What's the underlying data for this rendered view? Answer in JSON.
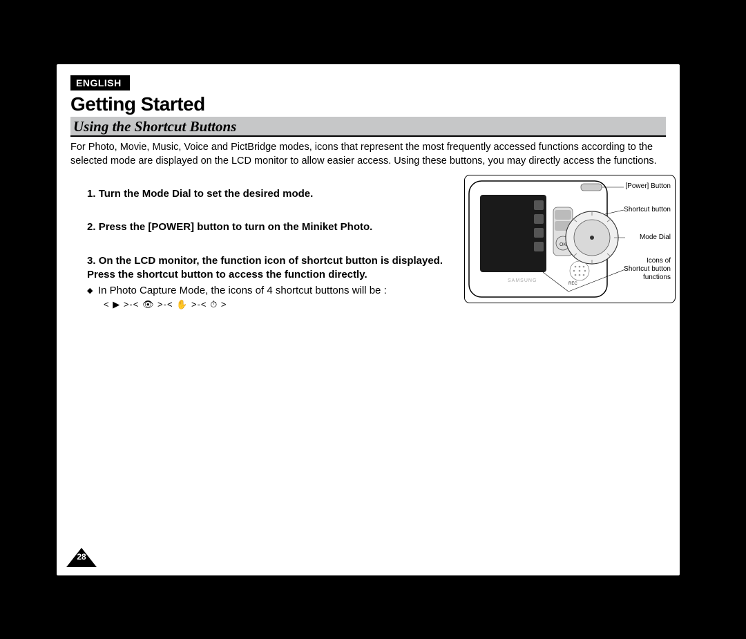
{
  "header": {
    "language": "ENGLISH",
    "title": "Getting Started",
    "subtitle": "Using the Shortcut Buttons"
  },
  "intro": "For Photo, Movie, Music, Voice and PictBridge modes, icons that represent the most frequently accessed functions according to the selected mode are displayed on the LCD monitor to allow easier access. Using these buttons, you may directly access the functions.",
  "steps": [
    {
      "text": "Turn the Mode Dial to set the desired mode."
    },
    {
      "text": "Press the [POWER] button to turn on the Miniket Photo."
    },
    {
      "text": "On the LCD monitor, the function icon of shortcut button is displayed.",
      "extra": "Press the shortcut button to access the function directly.",
      "bullet": "In Photo Capture Mode, the icons of 4 shortcut buttons will be :",
      "iconsLine": "<  ▶  >-<  👁  >-<  ✋  >-<  ⏱  >"
    }
  ],
  "diagram": {
    "labels": {
      "power": "[Power] Button",
      "shortcut": "Shortcut button",
      "modeDial": "Mode Dial",
      "iconsOf": "Icons of",
      "shortcutBtn": "Shortcut button",
      "functions": "functions"
    }
  },
  "pageNumber": "28"
}
